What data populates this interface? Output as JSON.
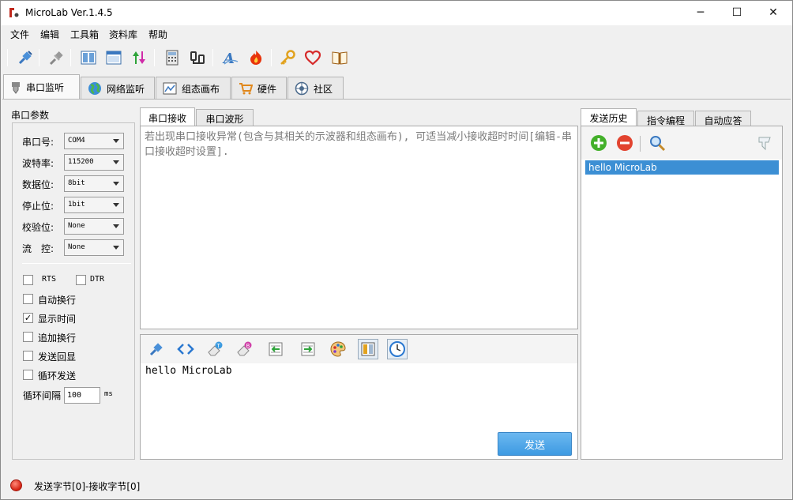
{
  "window": {
    "title": "MicroLab Ver.1.4.5",
    "minimize": "─",
    "maximize": "☐",
    "close": "✕"
  },
  "menu": [
    "文件",
    "编辑",
    "工具箱",
    "资料库",
    "帮助"
  ],
  "main_tabs": [
    "串口监听",
    "网络监听",
    "组态画布",
    "硬件",
    "社区"
  ],
  "serial_params": {
    "title": "串口参数",
    "fields": [
      {
        "label": "串口号:",
        "value": "COM4"
      },
      {
        "label": "波特率:",
        "value": "115200"
      },
      {
        "label": "数据位:",
        "value": "8bit"
      },
      {
        "label": "停止位:",
        "value": "1bit"
      },
      {
        "label": "校验位:",
        "value": "None"
      },
      {
        "label": "流　控:",
        "value": "None"
      }
    ],
    "rts": {
      "label": "RTS",
      "checked": false
    },
    "dtr": {
      "label": "DTR",
      "checked": false
    },
    "options": [
      {
        "label": "自动换行",
        "checked": false
      },
      {
        "label": "显示时间",
        "checked": true
      },
      {
        "label": "追加换行",
        "checked": false
      },
      {
        "label": "发送回显",
        "checked": false
      },
      {
        "label": "循环发送",
        "checked": false
      }
    ],
    "interval": {
      "label": "循环间隔",
      "value": "100",
      "unit": "ms"
    }
  },
  "rx": {
    "tabs": [
      "串口接收",
      "串口波形"
    ],
    "hint": "若出现串口接收异常(包含与其相关的示波器和组态画布), 可适当减小接收超时时间[编辑-串口接收超时设置]."
  },
  "tx": {
    "text": "hello MicroLab",
    "send_label": "发送"
  },
  "history": {
    "tabs": [
      "发送历史",
      "指令编程",
      "自动应答"
    ],
    "items": [
      "hello MicroLab"
    ]
  },
  "status": {
    "text": "发送字节[0]-接收字节[0]",
    "color": "#d42010"
  }
}
